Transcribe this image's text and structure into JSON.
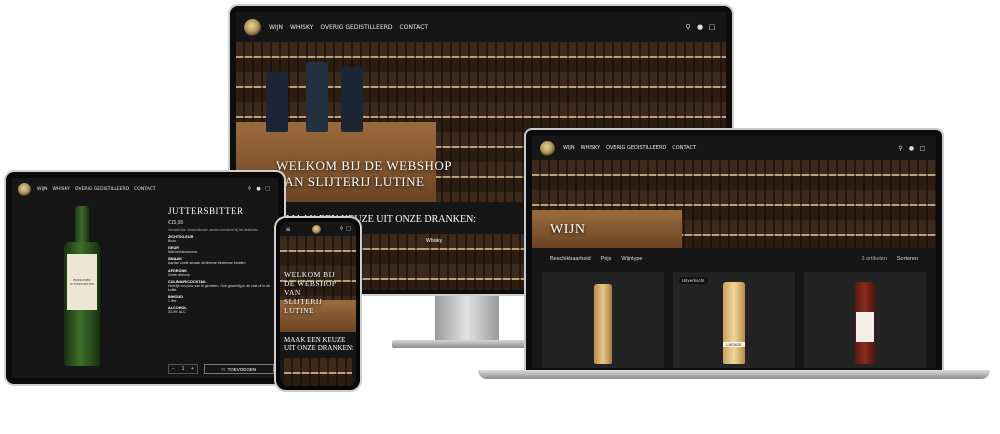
{
  "nav": {
    "items": [
      "WIJN",
      "WHISKY",
      "OVERIG GEDISTILLEERD",
      "CONTACT"
    ]
  },
  "icons": {
    "search": "search-icon",
    "account": "user-icon",
    "cart": "cart-icon"
  },
  "monitor": {
    "hero_line1": "WELKOM BIJ DE WEBSHOP",
    "hero_line2": "VAN SLIJTERIJ LUTINE",
    "section_title": "MAAK EEN KEUZE UIT ONZE DRANKEN:",
    "tile_label": "Whisky"
  },
  "laptop": {
    "banner_title": "WIJN",
    "filters": [
      "Beschikbaarheid",
      "Prijs",
      "Wijntype"
    ],
    "count": "3 artikelen",
    "sort": "Sorteren",
    "badge": "Uitverkocht",
    "product_label_2": "LAFAGE"
  },
  "tablet": {
    "product_title": "JUTTERSBITTER",
    "price": "€15,95",
    "tax_note": "Inclusief btw. Verzendkosten worden berekend bij het afrekenen.",
    "specs": [
      {
        "h": "ZICHT/KLEUR",
        "v": "Bruin."
      },
      {
        "h": "GEUR",
        "v": "Mild kruidenaroma."
      },
      {
        "h": "SMAAK",
        "v": "Aardse zoete smaak uit diverse inheemse kruiden."
      },
      {
        "h": "AFDRONK",
        "v": "Zoete afdronk."
      },
      {
        "h": "CULINAIR/COCKTAIL",
        "v": "Heerlijk om puur van te genieten. Ook geweldig in de cola of in de koffie."
      },
      {
        "h": "INHOUD",
        "v": "1 liter"
      },
      {
        "h": "ALCOHOL",
        "v": "33,5% ALC"
      }
    ],
    "qty": "1",
    "add_button": "TOEVOEGEN",
    "bottle_label": "BORKUMER JUTTERS-BITTER"
  },
  "phone": {
    "hero": "WELKOM BIJ DE WEBSHOP VAN SLIJTERIJ LUTINE",
    "section_title": "MAAK EEN KEUZE UIT ONZE DRANKEN:"
  }
}
